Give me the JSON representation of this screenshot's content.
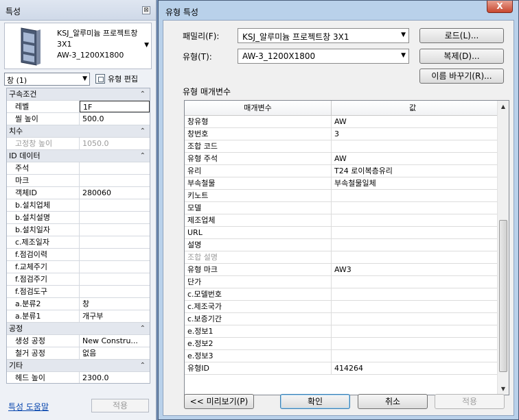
{
  "properties_panel": {
    "title": "특성",
    "close_label": "⊠",
    "type_name": "KSJ_알루미늄 프로젝트창 3X1\nAW-3_1200X1800",
    "instance_selector": "창 (1)",
    "edit_type_label": "유형 편집",
    "rows": [
      {
        "kind": "cat",
        "name": "구속조건"
      },
      {
        "kind": "p",
        "name": "레벨",
        "value": "1F",
        "edit": true
      },
      {
        "kind": "p",
        "name": "씰 높이",
        "value": "500.0"
      },
      {
        "kind": "cat",
        "name": "치수"
      },
      {
        "kind": "p",
        "name": "고정창 높이",
        "value": "1050.0",
        "disabled": true
      },
      {
        "kind": "cat",
        "name": "ID 데이터"
      },
      {
        "kind": "p",
        "name": "주석",
        "value": ""
      },
      {
        "kind": "p",
        "name": "마크",
        "value": ""
      },
      {
        "kind": "p",
        "name": "객체ID",
        "value": "280060"
      },
      {
        "kind": "p",
        "name": "b.설치업체",
        "value": ""
      },
      {
        "kind": "p",
        "name": "b.설치설명",
        "value": ""
      },
      {
        "kind": "p",
        "name": "b.설치일자",
        "value": ""
      },
      {
        "kind": "p",
        "name": "c.제조일자",
        "value": ""
      },
      {
        "kind": "p",
        "name": "f.점검이력",
        "value": ""
      },
      {
        "kind": "p",
        "name": "f.교체주기",
        "value": ""
      },
      {
        "kind": "p",
        "name": "f.점검주기",
        "value": ""
      },
      {
        "kind": "p",
        "name": "f.점검도구",
        "value": ""
      },
      {
        "kind": "p",
        "name": "a.분류2",
        "value": "창"
      },
      {
        "kind": "p",
        "name": "a.분류1",
        "value": "개구부"
      },
      {
        "kind": "cat",
        "name": "공정"
      },
      {
        "kind": "p",
        "name": "생성 공정",
        "value": "New Constru..."
      },
      {
        "kind": "p",
        "name": "철거 공정",
        "value": "없음"
      },
      {
        "kind": "cat",
        "name": "기타"
      },
      {
        "kind": "p",
        "name": "헤드 높이",
        "value": "2300.0"
      }
    ],
    "help_link": "특성 도움말",
    "apply_label": "적용"
  },
  "dialog": {
    "title": "유형 특성",
    "close_label": "X",
    "family_label": "패밀리(F):",
    "family_value": "KSJ_알루미늄 프로젝트창 3X1",
    "type_label": "유형(T):",
    "type_value": "AW-3_1200X1800",
    "load_label": "로드(L)...",
    "duplicate_label": "복제(D)...",
    "rename_label": "이름 바꾸기(R)...",
    "params_label": "유형 매개변수",
    "col_param": "매개변수",
    "col_value": "값",
    "params": [
      {
        "name": "창유형",
        "value": "AW"
      },
      {
        "name": "창번호",
        "value": "3"
      },
      {
        "name": "조합 코드",
        "value": ""
      },
      {
        "name": "유형 주석",
        "value": "AW"
      },
      {
        "name": "유리",
        "value": "T24 로이복층유리"
      },
      {
        "name": "부속철물",
        "value": "부속철물일체"
      },
      {
        "name": "키노트",
        "value": ""
      },
      {
        "name": "모델",
        "value": ""
      },
      {
        "name": "제조업체",
        "value": ""
      },
      {
        "name": "URL",
        "value": ""
      },
      {
        "name": "설명",
        "value": ""
      },
      {
        "name": "조합 설명",
        "value": "",
        "disabled": true
      },
      {
        "name": "유형 마크",
        "value": "AW3"
      },
      {
        "name": "단가",
        "value": ""
      },
      {
        "name": "c.모델번호",
        "value": ""
      },
      {
        "name": "c.제조국가",
        "value": ""
      },
      {
        "name": "c.보증기간",
        "value": ""
      },
      {
        "name": "e.정보1",
        "value": ""
      },
      {
        "name": "e.정보2",
        "value": ""
      },
      {
        "name": "e.정보3",
        "value": ""
      },
      {
        "name": "유형ID",
        "value": "414264"
      }
    ],
    "preview_label": "<< 미리보기(P)",
    "ok_label": "확인",
    "cancel_label": "취소",
    "apply_label": "적용"
  }
}
